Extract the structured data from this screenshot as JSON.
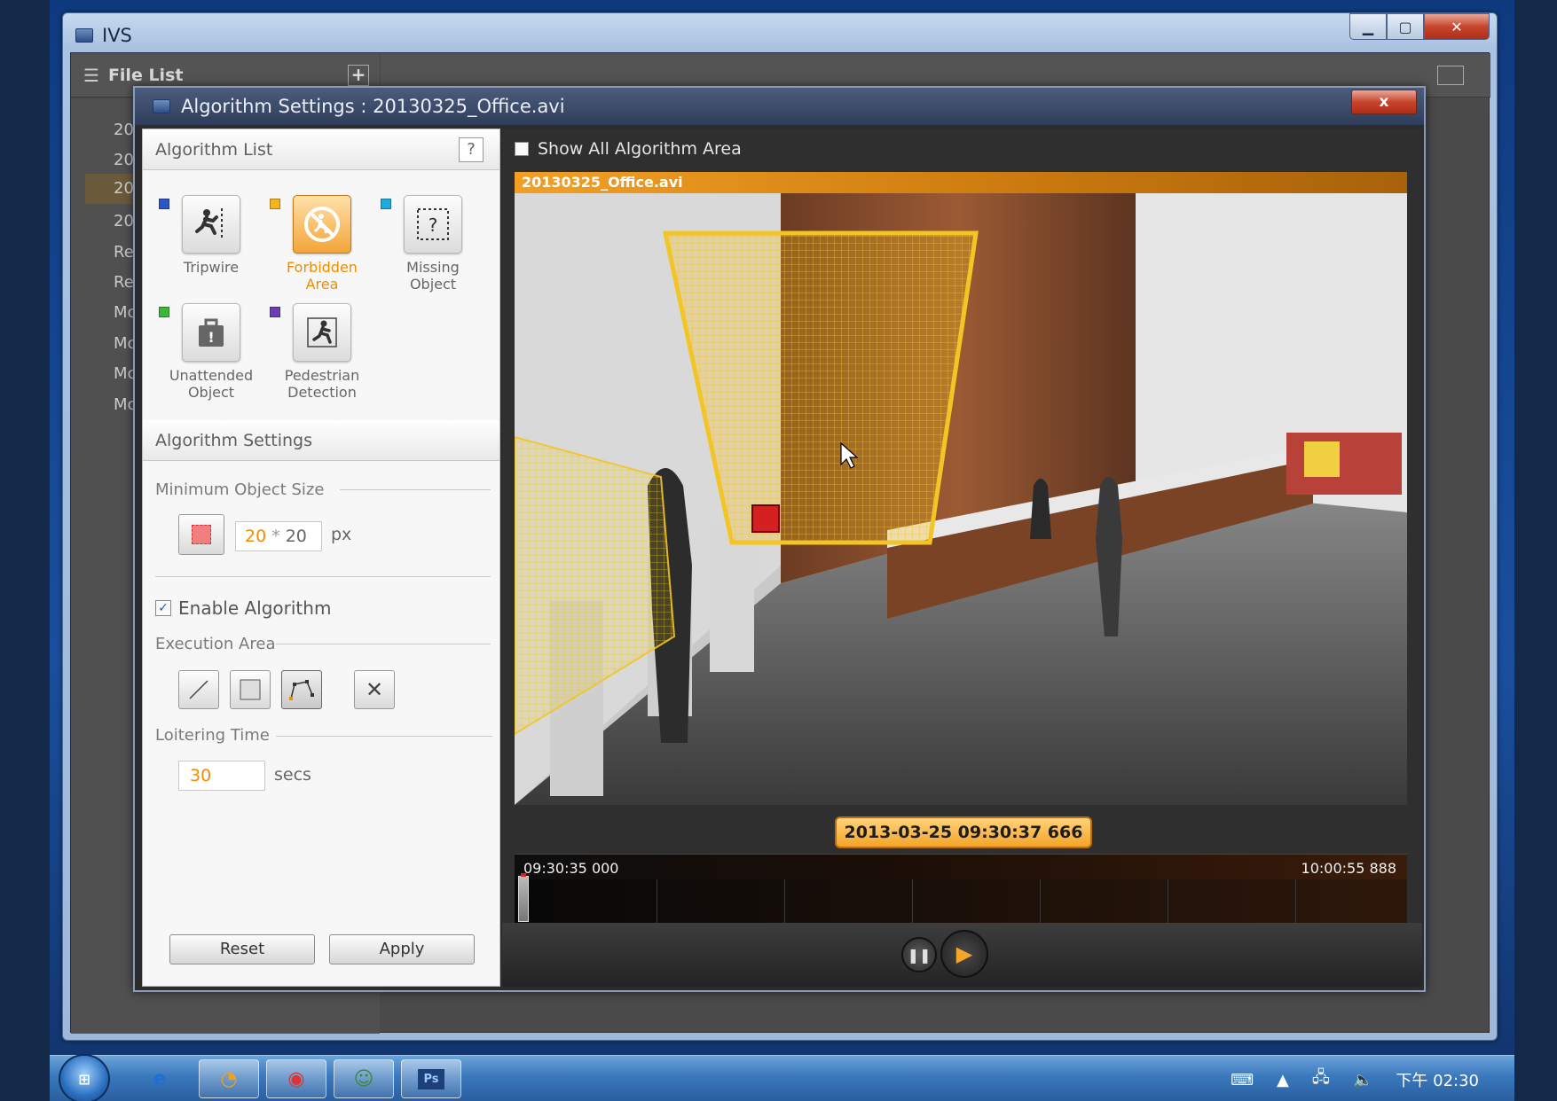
{
  "ivs_window": {
    "title": "IVS"
  },
  "file_list": {
    "title": "File List",
    "items": [
      "20",
      "20",
      "20",
      "20",
      "Re",
      "Re",
      "Mc",
      "Mc",
      "Mc",
      "Mc"
    ],
    "selected_index": 2
  },
  "dialog": {
    "title": "Algorithm Settings : 20130325_Office.avi",
    "close_label": "x"
  },
  "algorithm_list": {
    "title": "Algorithm List",
    "help_label": "?",
    "items": [
      {
        "label": "Tripwire",
        "color": "#2b56c8",
        "icon": "running-man-tripwire-icon"
      },
      {
        "label": "Forbidden Area",
        "color": "#f3b520",
        "icon": "forbidden-icon",
        "active": true
      },
      {
        "label": "Missing Object",
        "color": "#20a9e0",
        "icon": "missing-object-icon"
      },
      {
        "label": "Unattended Object",
        "color": "#3fb43a",
        "icon": "unattended-bag-icon"
      },
      {
        "label": "Pedestrian Detection",
        "color": "#6a3fae",
        "icon": "pedestrian-icon"
      }
    ]
  },
  "algorithm_settings": {
    "title": "Algorithm Settings",
    "min_object_size_label": "Minimum Object Size",
    "min_w": "20",
    "times": "*",
    "min_h": "20",
    "unit": "px",
    "enable_label": "Enable Algorithm",
    "enabled": true,
    "execution_area_label": "Execution Area",
    "loitering_label": "Loitering Time",
    "loitering_value": "30",
    "loitering_unit": "secs",
    "reset_label": "Reset",
    "apply_label": "Apply"
  },
  "video": {
    "show_all_label": "Show All Algorithm Area",
    "filename": "20130325_Office.avi",
    "timestamp": "2013-03-25 09:30:37 666",
    "timeline_start": "09:30:35 000",
    "timeline_end": "10:00:55 888",
    "area_color": "#f2c624"
  },
  "taskbar": {
    "clock": "下午 02:30"
  }
}
